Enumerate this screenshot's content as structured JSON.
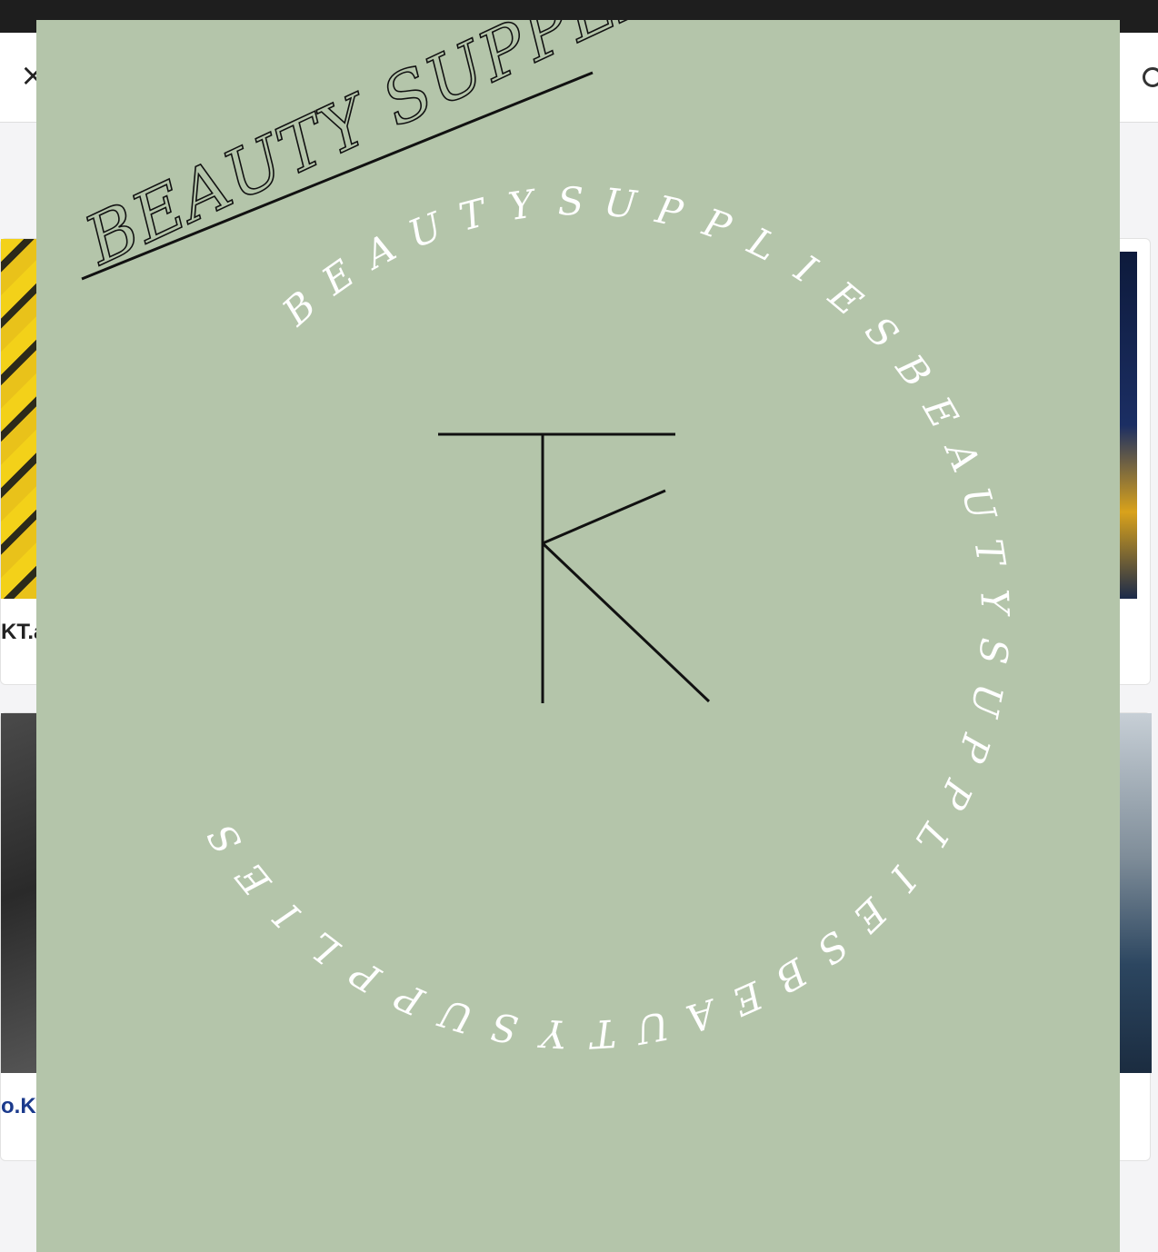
{
  "background_page": {
    "close_icon": "close-icon",
    "right_icon": "circle-icon",
    "card_captions": [
      "KT.a",
      "o.KT"
    ],
    "colors": {
      "link": "#1b3a8c",
      "page_bg": "#f4f4f6"
    }
  },
  "viewer": {
    "image": {
      "title": "BEAUTY SUPPLIES",
      "monogram": "TK",
      "ring_text": "BEAUTYSUPPLIESBEAUTYSUPPLIESBEAUTYSUPPLIES",
      "colors": {
        "background": "#b4c5aa",
        "ring_text": "#ffffff",
        "monogram": "#111111"
      }
    }
  }
}
